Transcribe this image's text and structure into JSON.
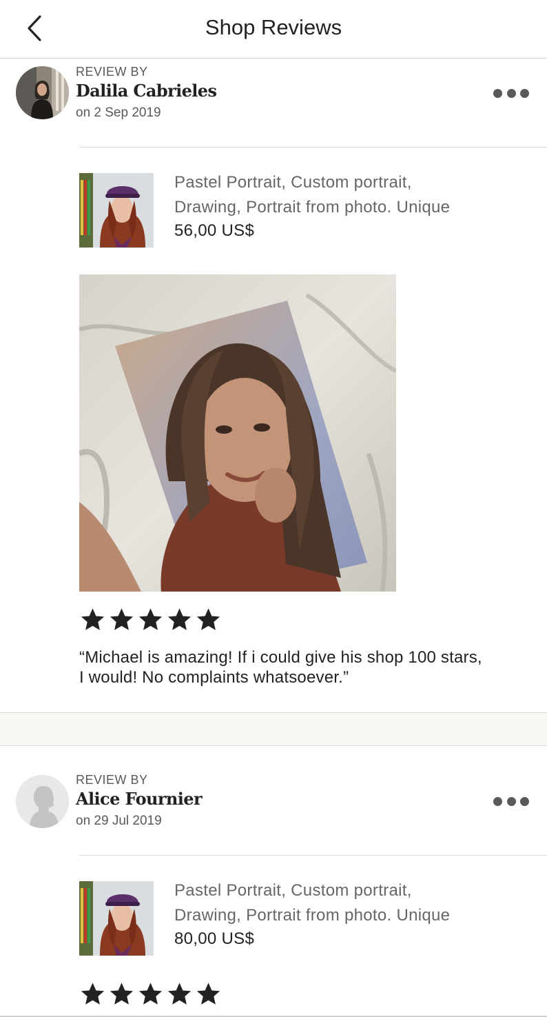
{
  "header": {
    "title": "Shop Reviews",
    "back_icon": "chevron-left-icon"
  },
  "reviews": [
    {
      "label": "REVIEW BY",
      "name": "Dalila Cabrieles",
      "date": "on 2 Sep 2019",
      "more_icon": "more-horizontal-icon",
      "listing": {
        "title_line1": "Pastel Portrait, Custom portrait,",
        "title_line2": "Drawing, Portrait from photo. Unique",
        "price": "56,00 US$"
      },
      "rating": 5,
      "text_line1": "“Michael is amazing! If i could give his shop 100 stars,",
      "text_line2": "I would!  No complaints whatsoever.”"
    },
    {
      "label": "REVIEW BY",
      "name": "Alice Fournier",
      "date": "on 29 Jul 2019",
      "more_icon": "more-horizontal-icon",
      "listing": {
        "title_line1": "Pastel Portrait, Custom portrait,",
        "title_line2": "Drawing, Portrait from photo. Unique",
        "price": "80,00 US$"
      },
      "rating": 5
    }
  ],
  "colors": {
    "text_primary": "#222222",
    "text_secondary": "#595959",
    "divider": "#dcdcdc",
    "section_bg": "#f7f7f4"
  }
}
